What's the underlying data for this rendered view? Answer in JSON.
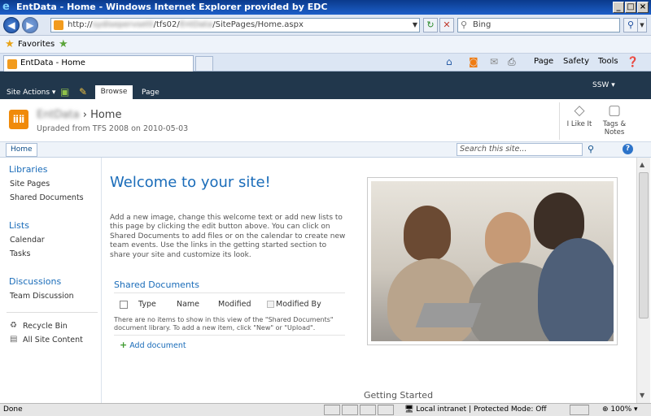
{
  "window": {
    "title": "EntData - Home - Windows Internet Explorer provided by EDC",
    "minimize": "_",
    "maximize": "□",
    "close": "×"
  },
  "address_bar": {
    "url_prefix": "http://",
    "url_blurred_1": "sydisepervsetli",
    "url_mid": "/tfs02/",
    "url_blurred_2": "EntData",
    "url_suffix": "/SitePages/Home.aspx",
    "search_placeholder": "Bing"
  },
  "favorites_bar": {
    "label": "Favorites"
  },
  "tabs": [
    {
      "label": "EntData - Home"
    }
  ],
  "command_bar": {
    "page": "Page",
    "safety": "Safety",
    "tools": "Tools"
  },
  "ribbon": {
    "site_actions": "Site Actions",
    "tab_browse": "Browse",
    "tab_page": "Page",
    "user": "SSW"
  },
  "header": {
    "site_name_blurred": "EntData",
    "separator": "›",
    "page_name": "Home",
    "subtitle": "Upraded from TFS 2008 on 2010-05-03",
    "i_like_it": "I Like It",
    "tags_notes": "Tags & Notes"
  },
  "top_nav": {
    "home": "Home",
    "search_placeholder": "Search this site..."
  },
  "left_nav": {
    "libraries_heading": "Libraries",
    "libraries": [
      "Site Pages",
      "Shared Documents"
    ],
    "lists_heading": "Lists",
    "lists": [
      "Calendar",
      "Tasks"
    ],
    "discussions_heading": "Discussions",
    "discussions": [
      "Team Discussion"
    ],
    "recycle_bin": "Recycle Bin",
    "all_site_content": "All Site Content"
  },
  "main": {
    "welcome_title": "Welcome to your site!",
    "intro": "Add a new image, change this welcome text or add new lists to this page by clicking the edit button above. You can click on Shared Documents to add files or on the calendar to create new team events. Use the links in the getting started section to share your site and customize its look.",
    "shared_docs": {
      "title": "Shared Documents",
      "columns": [
        "Type",
        "Name",
        "Modified",
        "Modified By"
      ],
      "empty_message": "There are no items to show in this view of the \"Shared Documents\" document library. To add a new item, click \"New\" or \"Upload\".",
      "add_document": "Add document"
    },
    "getting_started": "Getting Started"
  },
  "status_bar": {
    "status": "Done",
    "zone": "Local intranet | Protected Mode: Off",
    "zoom": "100%"
  },
  "colors": {
    "ribbon_bg": "#21374c",
    "link_blue": "#1a6cb9",
    "site_icon_orange": "#f08a0a"
  }
}
